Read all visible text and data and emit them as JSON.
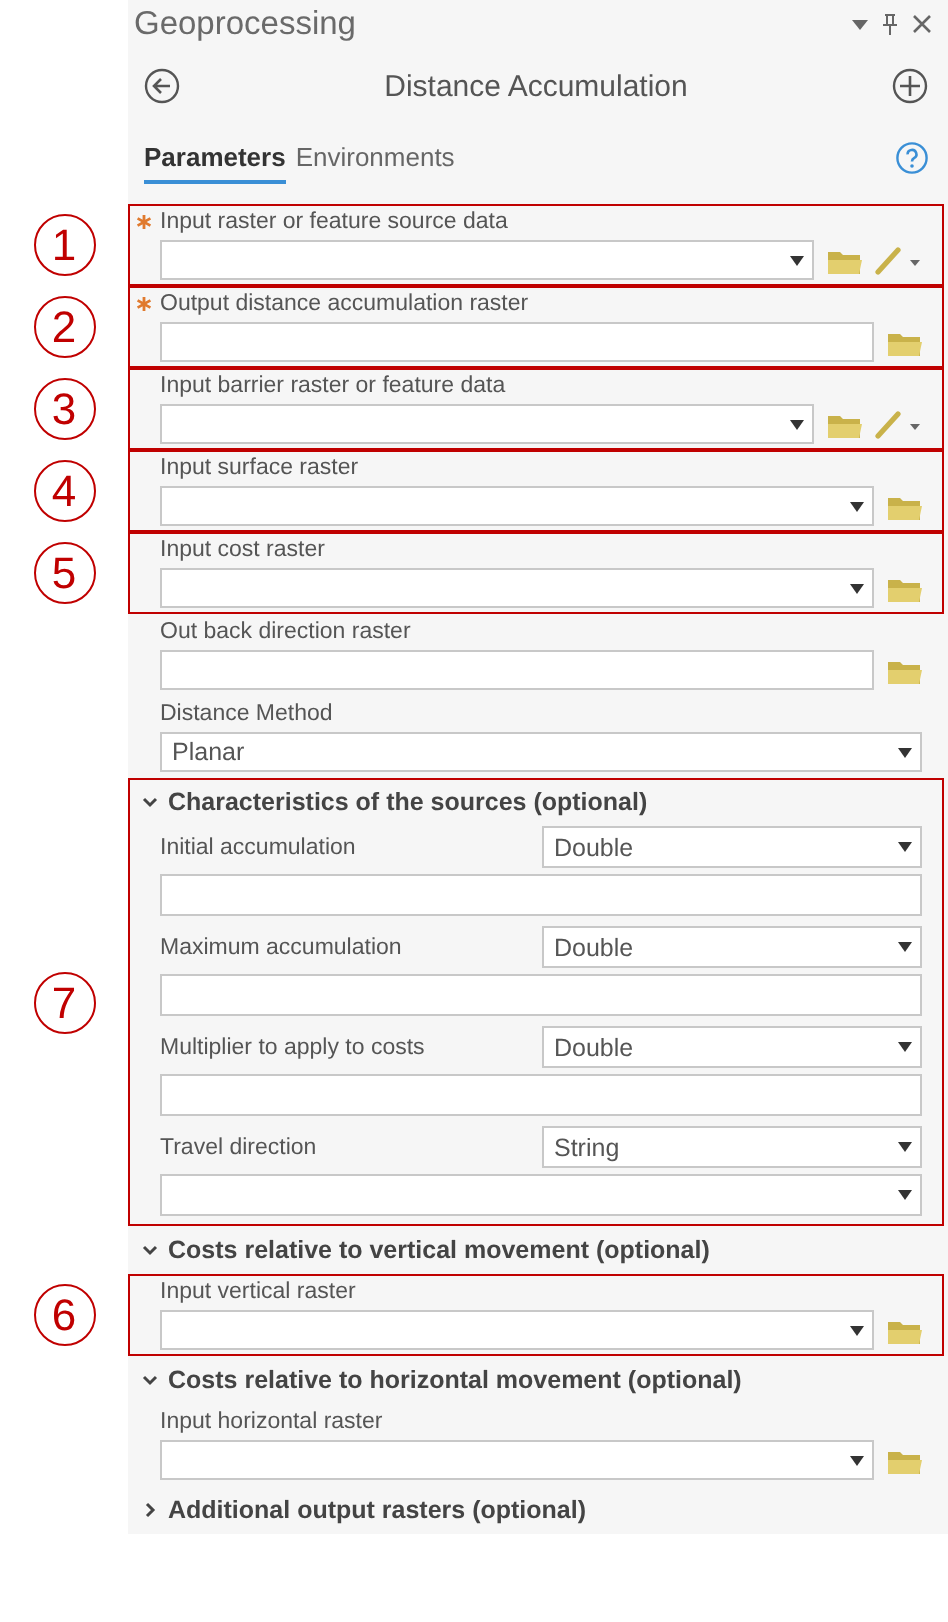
{
  "panel": {
    "title": "Geoprocessing"
  },
  "tool": {
    "title": "Distance Accumulation"
  },
  "tabs": [
    {
      "label": "Parameters",
      "selected": true
    },
    {
      "label": "Environments",
      "selected": false
    }
  ],
  "parameters": [
    {
      "kind": "param",
      "callout": "1",
      "required": true,
      "label": "Input raster or feature source data",
      "dropdown": true,
      "browse": true,
      "sketch": true
    },
    {
      "kind": "param",
      "callout": "2",
      "required": true,
      "label": "Output distance accumulation raster",
      "dropdown": false,
      "browse": true,
      "sketch": false
    },
    {
      "kind": "param",
      "callout": "3",
      "required": false,
      "label": "Input barrier raster or feature data",
      "dropdown": true,
      "browse": true,
      "sketch": true
    },
    {
      "kind": "param",
      "callout": "4",
      "required": false,
      "label": "Input surface raster",
      "dropdown": true,
      "browse": true,
      "sketch": false
    },
    {
      "kind": "param",
      "callout": "5",
      "required": false,
      "label": "Input cost raster",
      "dropdown": true,
      "browse": true,
      "sketch": false
    },
    {
      "kind": "param",
      "required": false,
      "label": "Out back direction raster",
      "dropdown": false,
      "browse": true,
      "sketch": false
    },
    {
      "kind": "param",
      "required": false,
      "label": "Distance Method",
      "value": "Planar",
      "dropdown": true,
      "browse": false,
      "sketch": false
    },
    {
      "kind": "group",
      "callout": "7",
      "title": "Characteristics of the sources (optional)",
      "expanded": true,
      "children": [
        {
          "kind": "typed",
          "label": "Initial accumulation",
          "type": "Double",
          "dropdown": false
        },
        {
          "kind": "typed",
          "label": "Maximum accumulation",
          "type": "Double",
          "dropdown": false
        },
        {
          "kind": "typed",
          "label": "Multiplier to apply to costs",
          "type": "Double",
          "dropdown": false
        },
        {
          "kind": "typed",
          "label": "Travel direction",
          "type": "String",
          "dropdown": true
        }
      ]
    },
    {
      "kind": "group",
      "title": "Costs relative to vertical movement (optional)",
      "expanded": true,
      "children": [
        {
          "kind": "param",
          "callout": "6",
          "required": false,
          "label": "Input vertical raster",
          "dropdown": true,
          "browse": true,
          "sketch": false
        }
      ]
    },
    {
      "kind": "group",
      "title": "Costs relative to horizontal movement (optional)",
      "expanded": true,
      "children": [
        {
          "kind": "param",
          "required": false,
          "label": "Input horizontal raster",
          "dropdown": true,
          "browse": true,
          "sketch": false
        }
      ]
    },
    {
      "kind": "group",
      "title": "Additional output rasters (optional)",
      "expanded": false
    }
  ]
}
